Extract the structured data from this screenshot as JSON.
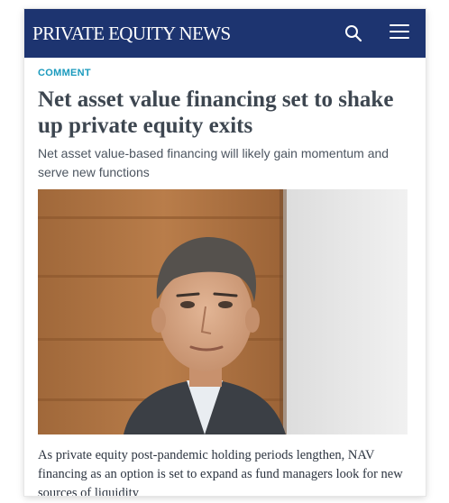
{
  "header": {
    "brand": "PRIVATE EQUITY NEWS",
    "search_icon": "search-icon",
    "menu_icon": "hamburger-menu-icon",
    "background_color": "#1d3470"
  },
  "article": {
    "section": "COMMENT",
    "headline": "Net asset value financing set to shake up private equity exits",
    "standfirst": "Net asset value-based financing will likely gain momentum and serve new functions",
    "body": "As private equity post-pandemic holding periods lengthen, NAV financing as an option is set to expand as fund managers look for new sources of liquidity"
  },
  "colors": {
    "accent": "#1a9abd",
    "headline": "#3d4650"
  }
}
